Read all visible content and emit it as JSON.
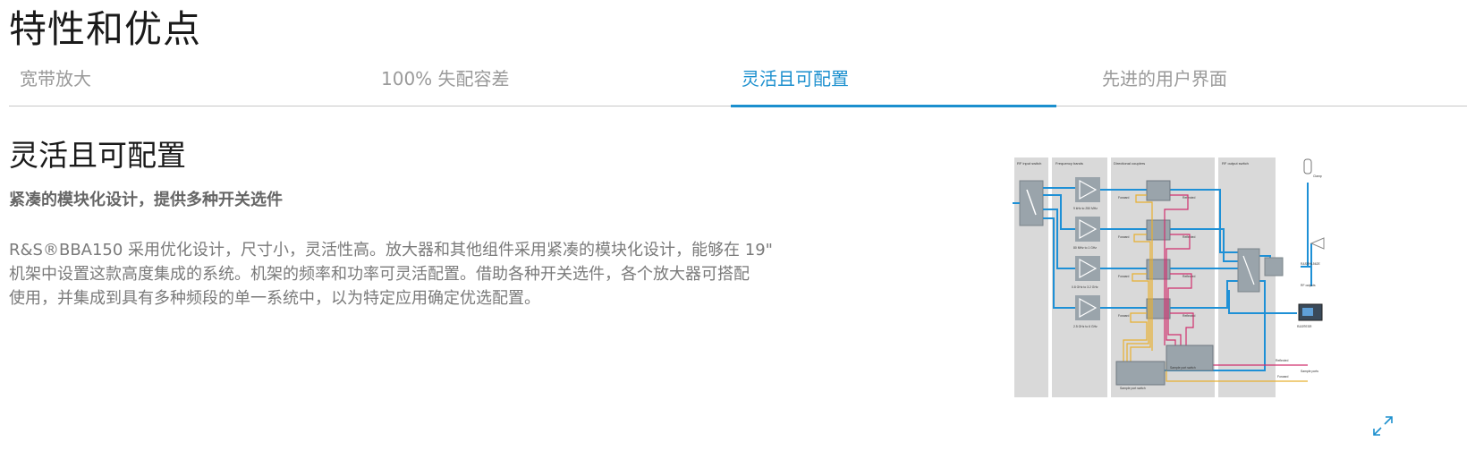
{
  "page": {
    "title": "特性和优点"
  },
  "tabs": [
    {
      "label": "宽带放大",
      "active": false
    },
    {
      "label": "100% 失配容差",
      "active": false
    },
    {
      "label": "灵活且可配置",
      "active": true
    },
    {
      "label": "先进的用户界面",
      "active": false
    }
  ],
  "content": {
    "heading": "灵活且可配置",
    "subheading": "紧凑的模块化设计，提供多种开关选件",
    "body_lines": [
      "R&S®BBA150 采用优化设计，尺寸小，灵活性高。放大器和其他组件采用紧凑的模块化设计，能够在 19\"",
      "机架中设置这款高度集成的系统。机架的频率和功率可灵活配置。借助各种开关选件，各个放大器可搭配",
      "使用，并集成到具有多种频段的单一系统中，以为特定应用确定优选配置。"
    ]
  },
  "diagram": {
    "columns": [
      "RF input switch",
      "Frequency bands",
      "Directional couplers",
      "RF output switch"
    ],
    "bands": [
      "9 kHz to 250 MHz",
      "80 MHz to 1 GHz",
      "0.8 GHz to 3.2 GHz",
      "2.5 GHz to 6 GHz"
    ],
    "coupler_forward": "Forward",
    "coupler_reflected": "Reflected",
    "outputs": [
      "Clamp",
      "R&S®HL562E",
      "RF outputs",
      "R&S®ESR"
    ],
    "sample_switch_label": "Sample port switch",
    "bottom_labels": [
      "Reflected",
      "Sample ports",
      "Forward"
    ],
    "colors": {
      "signal": "#1e90d6",
      "forward": "#e8b030",
      "reflected": "#d0306e",
      "accent": "#1b8fce"
    }
  },
  "icons": {
    "expand": "expand-icon"
  }
}
